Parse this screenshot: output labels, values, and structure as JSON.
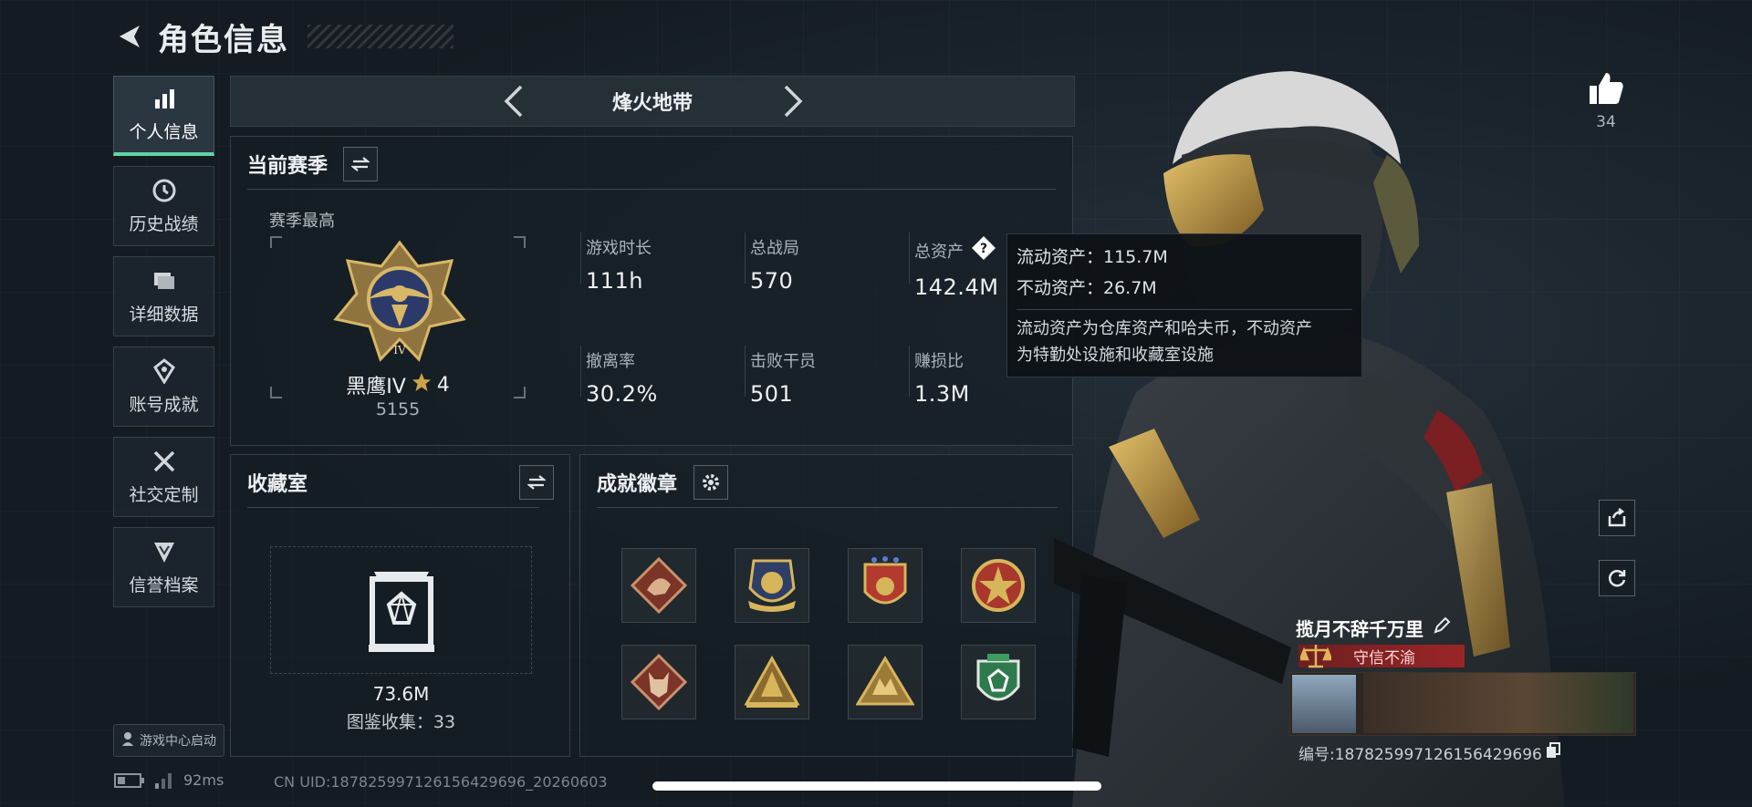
{
  "header": {
    "title": "角色信息"
  },
  "sidebar": {
    "items": [
      {
        "label": "个人信息",
        "icon": "bar-chart-icon",
        "active": true
      },
      {
        "label": "历史战绩",
        "icon": "clock-icon",
        "active": false
      },
      {
        "label": "详细数据",
        "icon": "folder-icon",
        "active": false
      },
      {
        "label": "账号成就",
        "icon": "trophy-icon",
        "active": false
      },
      {
        "label": "社交定制",
        "icon": "tools-icon",
        "active": false
      },
      {
        "label": "信誉档案",
        "icon": "shield-icon",
        "active": false
      }
    ],
    "launch_label": "游戏中心启动"
  },
  "mode": {
    "title": "烽火地带"
  },
  "season": {
    "title": "当前赛季",
    "highest_label": "赛季最高",
    "rank_name": "黑鹰IV",
    "rank_stars": "4",
    "rank_points": "5155",
    "stats": [
      {
        "label": "游戏时长",
        "value": "111h"
      },
      {
        "label": "总战局",
        "value": "570"
      },
      {
        "label": "总资产",
        "value": "142.4M"
      },
      {
        "label": "撤离率",
        "value": "30.2%"
      },
      {
        "label": "击败干员",
        "value": "501"
      },
      {
        "label": "赚损比",
        "value": "1.3M"
      }
    ]
  },
  "tooltip": {
    "liquid": "流动资产：115.7M",
    "fixed": "不动资产：26.7M",
    "desc_line1": "流动资产为仓库资产和哈夫币，不动资产",
    "desc_line2": "为特勤处设施和收藏室设施"
  },
  "collection": {
    "title": "收藏室",
    "value": "73.6M",
    "count_text": "图鉴收集：33"
  },
  "badges": {
    "title": "成就徽章",
    "items": [
      {
        "icon": "dragon-badge-icon",
        "color": "#b0563f"
      },
      {
        "icon": "wings-badge-icon",
        "color": "#c9a44a"
      },
      {
        "icon": "stars-badge-icon",
        "color": "#c74a3a"
      },
      {
        "icon": "medal-badge-icon",
        "color": "#b84a3c"
      },
      {
        "icon": "wolf-badge-icon",
        "color": "#b0563f"
      },
      {
        "icon": "triangle-badge-icon",
        "color": "#c9a44a"
      },
      {
        "icon": "pyramid-badge-icon",
        "color": "#c9a44a"
      },
      {
        "icon": "green-shield-badge-icon",
        "color": "#3f9a62"
      }
    ]
  },
  "like": {
    "count": "34"
  },
  "player": {
    "name": "揽月不辞千万里",
    "title": "守信不渝",
    "id_text": "编号:18782599712615642969­6"
  },
  "status": {
    "latency": "92ms",
    "uid": "CN UID:18782599712615642969­6_20260603"
  },
  "colors": {
    "accent": "#5fd3a8",
    "title_red": "#9b2527",
    "gold": "#c9a44a"
  }
}
